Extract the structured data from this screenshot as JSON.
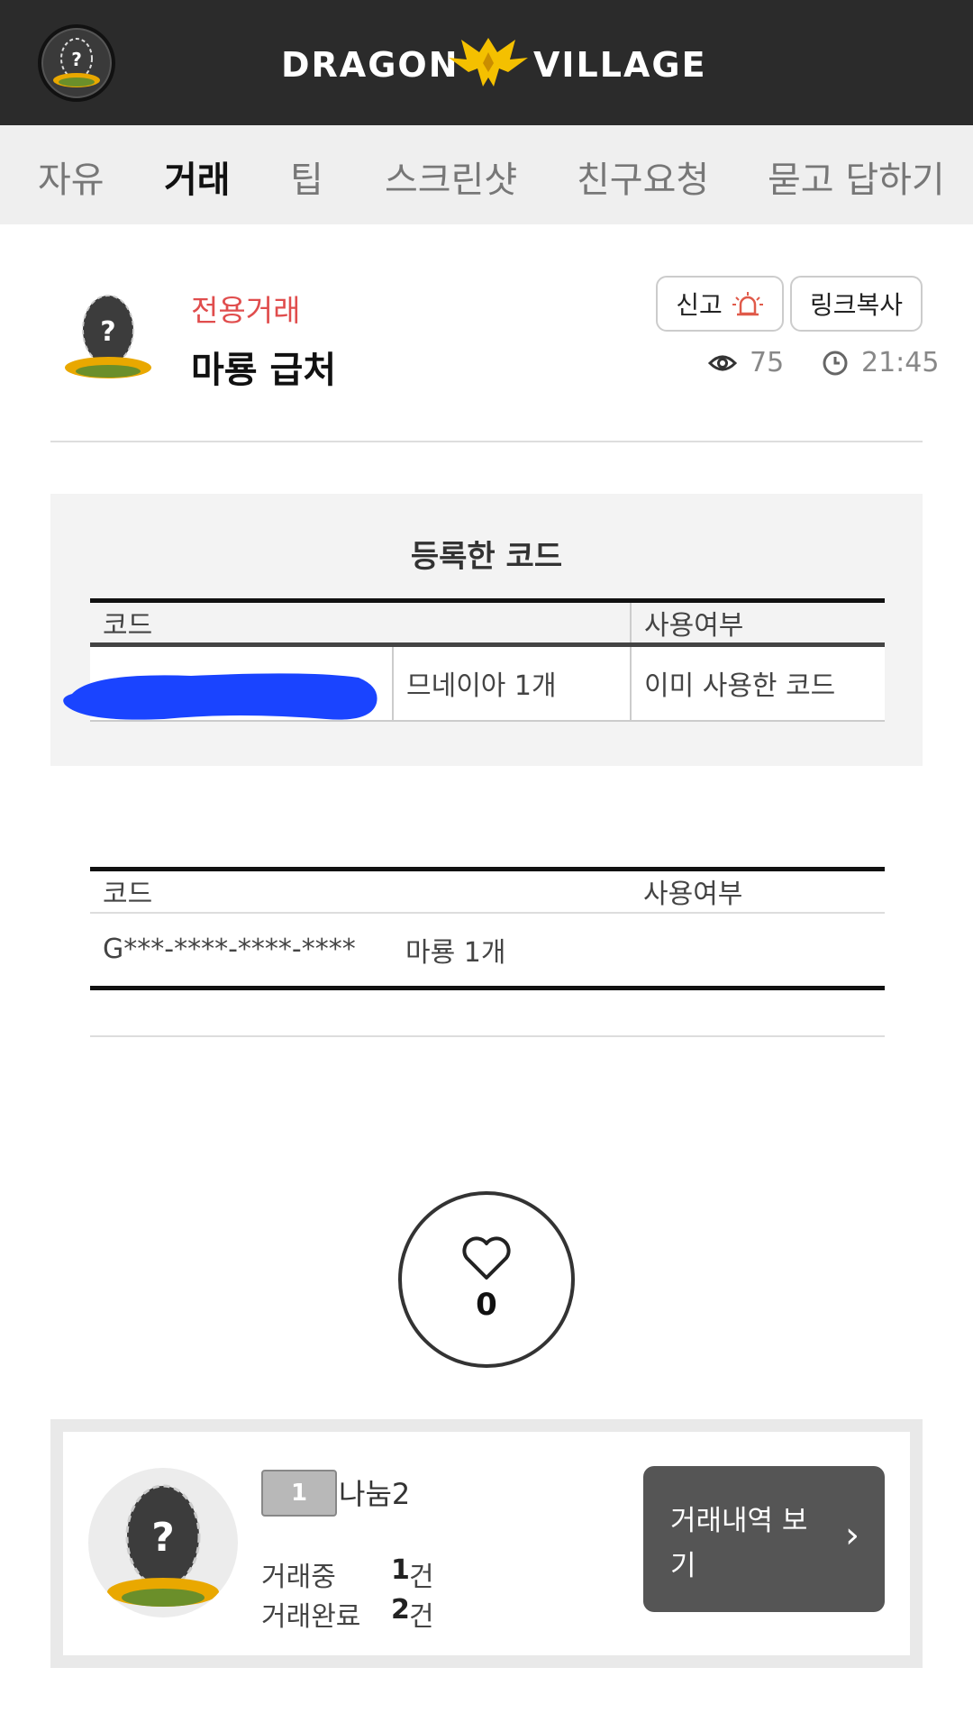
{
  "header": {
    "logo_left": "DRAGON",
    "logo_right": "VILLAGE"
  },
  "tabs": [
    {
      "label": "자유",
      "active": false
    },
    {
      "label": "거래",
      "active": true
    },
    {
      "label": "팁",
      "active": false
    },
    {
      "label": "스크린샷",
      "active": false
    },
    {
      "label": "친구요청",
      "active": false
    },
    {
      "label": "묻고 답하기",
      "active": false
    }
  ],
  "post": {
    "category": "전용거래",
    "title": "마룡 급처",
    "report_label": "신고",
    "copy_link_label": "링크복사",
    "views": "75",
    "time": "21:45"
  },
  "registered": {
    "title": "등록한 코드",
    "col_code": "코드",
    "col_used": "사용여부",
    "row": {
      "item": "므네이아 1개",
      "status": "이미 사용한 코드"
    }
  },
  "codes": {
    "col_code": "코드",
    "col_used": "사용여부",
    "row": {
      "code": "G***-****-****-****",
      "item": "마룡 1개",
      "status": ""
    }
  },
  "like": {
    "count": "0"
  },
  "author": {
    "level": "1",
    "name": "나눔2",
    "trading_label": "거래중",
    "trading_count": "1",
    "done_label": "거래완료",
    "done_count": "2",
    "unit": "건",
    "history_button": "거래내역 보기"
  },
  "colors": {
    "header_bg": "#2b2b2b",
    "tab_highlight": "#f2c400",
    "category_red": "#e04d4d",
    "redaction_blue": "#1a44ff"
  }
}
